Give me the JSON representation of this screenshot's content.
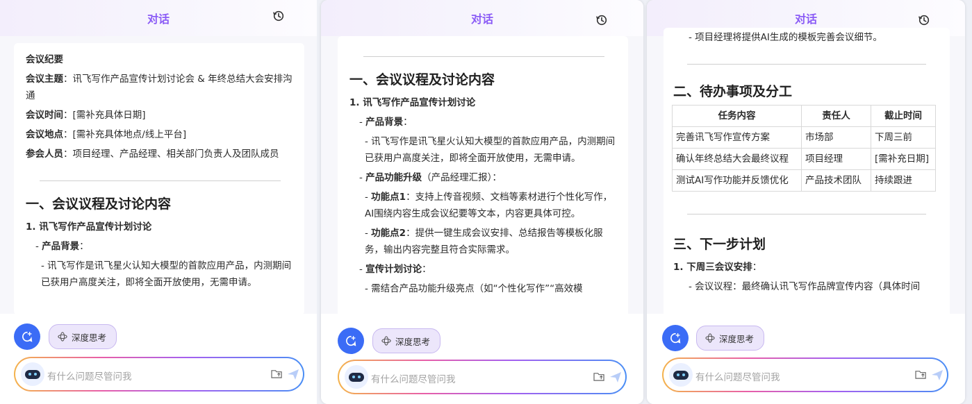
{
  "panels": [
    {
      "header_title": "对话",
      "doc": {
        "heading_minutes": "会议纪要",
        "topic_label": "会议主题",
        "topic_value": "：讯飞写作产品宣传计划讨论会 & 年终总结大会安排沟通",
        "time_label": "会议时间",
        "time_value": "：[需补充具体日期]",
        "place_label": "会议地点",
        "place_value": "：[需补充具体地点/线上平台]",
        "attendees_label": "参会人员",
        "attendees_value": "：项目经理、产品经理、相关部门负责人及团队成员",
        "section1": "一、会议议程及讨论内容",
        "item1": "1. 讯飞写作产品宣传计划讨论",
        "bg_label": "产品背景",
        "bg_colon": "：",
        "bg_text": "- 讯飞写作是讯飞星火认知大模型的首款应用产品，内测期间已获用户高度关注，即将全面开放使用，无需申请。"
      },
      "deep_think": "深度思考",
      "placeholder": "有什么问题尽管问我"
    },
    {
      "header_title": "对话",
      "doc": {
        "section1": "一、会议议程及讨论内容",
        "item1": "1. 讯飞写作产品宣传计划讨论",
        "bg_label": "产品背景",
        "bg_colon": "：",
        "bg_text": "- 讯飞写作是讯飞星火认知大模型的首款应用产品，内测期间已获用户高度关注，即将全面开放使用，无需申请。",
        "upgrade_label": "产品功能升级",
        "upgrade_note": "（产品经理汇报）：",
        "f1_label": "功能点1",
        "f1_text": "：支持上传音视频、文档等素材进行个性化写作，AI围绕内容生成会议纪要等文本，内容更具体可控。",
        "f2_label": "功能点2",
        "f2_text": "：提供一键生成会议安排、总结报告等模板化服务，输出内容完整且符合实际需求。",
        "promo_label": "宣传计划讨论",
        "promo_colon": "：",
        "promo_text": "- 需结合产品功能升级亮点（如“个性化写作”“高效模"
      },
      "deep_think": "深度思考",
      "placeholder": "有什么问题尽管问我"
    },
    {
      "header_title": "对话",
      "doc": {
        "top_line": "- 项目经理将提供AI生成的模板完善会议细节。",
        "section2": "二、待办事项及分工",
        "table_headers": [
          "任务内容",
          "责任人",
          "截止时间"
        ],
        "table_rows": [
          [
            "完善讯飞写作宣传方案",
            "市场部",
            "下周三前"
          ],
          [
            "确认年终总结大会最终议程",
            "项目经理",
            "[需补充日期]"
          ],
          [
            "测试AI写作功能并反馈优化",
            "产品技术团队",
            "持续跟进"
          ]
        ],
        "section3": "三、下一步计划",
        "next_item": "1. 下周三会议安排",
        "next_colon": "：",
        "next_text": "- 会议议程：最终确认讯飞写作品牌宣传内容（具体时间"
      },
      "deep_think": "深度思考",
      "placeholder": "有什么问题尽管问我"
    }
  ],
  "colors": {
    "accent_purple": "#8b5cf6",
    "new_chat_blue": "#3b6cf6"
  },
  "icons": [
    "history-icon",
    "new-chat-icon",
    "deep-think-icon",
    "robot-avatar-icon",
    "folder-upload-icon",
    "send-icon"
  ]
}
